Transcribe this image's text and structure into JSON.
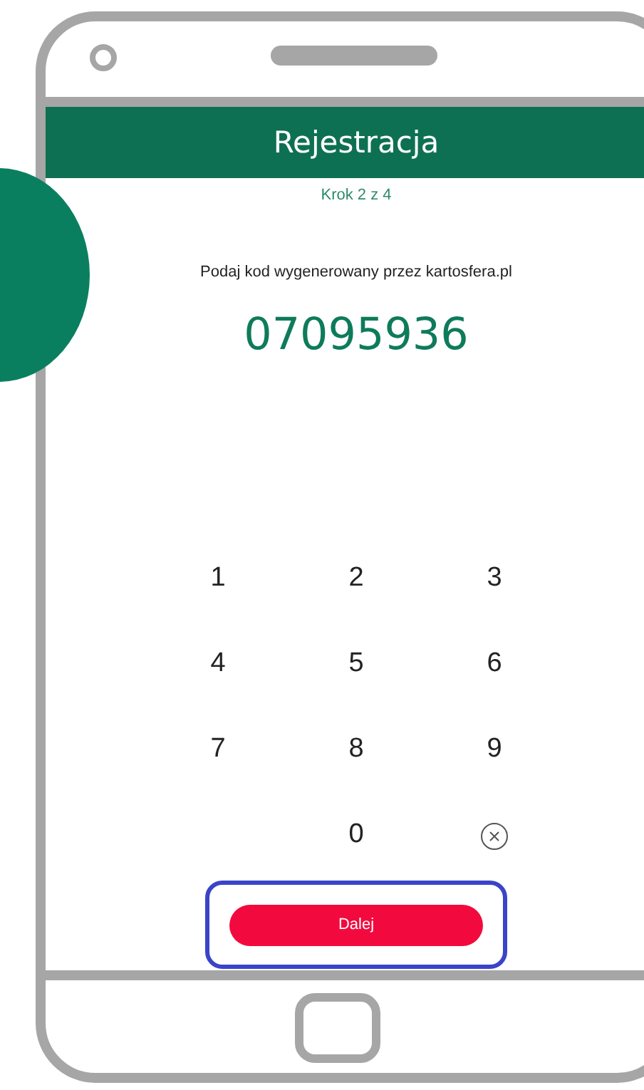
{
  "header": {
    "title": "Rejestracja"
  },
  "step": "Krok 2 z 4",
  "prompt": "Podaj kod wygenerowany przez kartosfera.pl",
  "code": "07095936",
  "keypad": [
    {
      "kind": "digit",
      "label": "1"
    },
    {
      "kind": "digit",
      "label": "2"
    },
    {
      "kind": "digit",
      "label": "3"
    },
    {
      "kind": "digit",
      "label": "4"
    },
    {
      "kind": "digit",
      "label": "5"
    },
    {
      "kind": "digit",
      "label": "6"
    },
    {
      "kind": "digit",
      "label": "7"
    },
    {
      "kind": "digit",
      "label": "8"
    },
    {
      "kind": "digit",
      "label": "9"
    },
    {
      "kind": "empty"
    },
    {
      "kind": "digit",
      "label": "0"
    },
    {
      "kind": "delete"
    }
  ],
  "next_button": {
    "label": "Dalej"
  }
}
